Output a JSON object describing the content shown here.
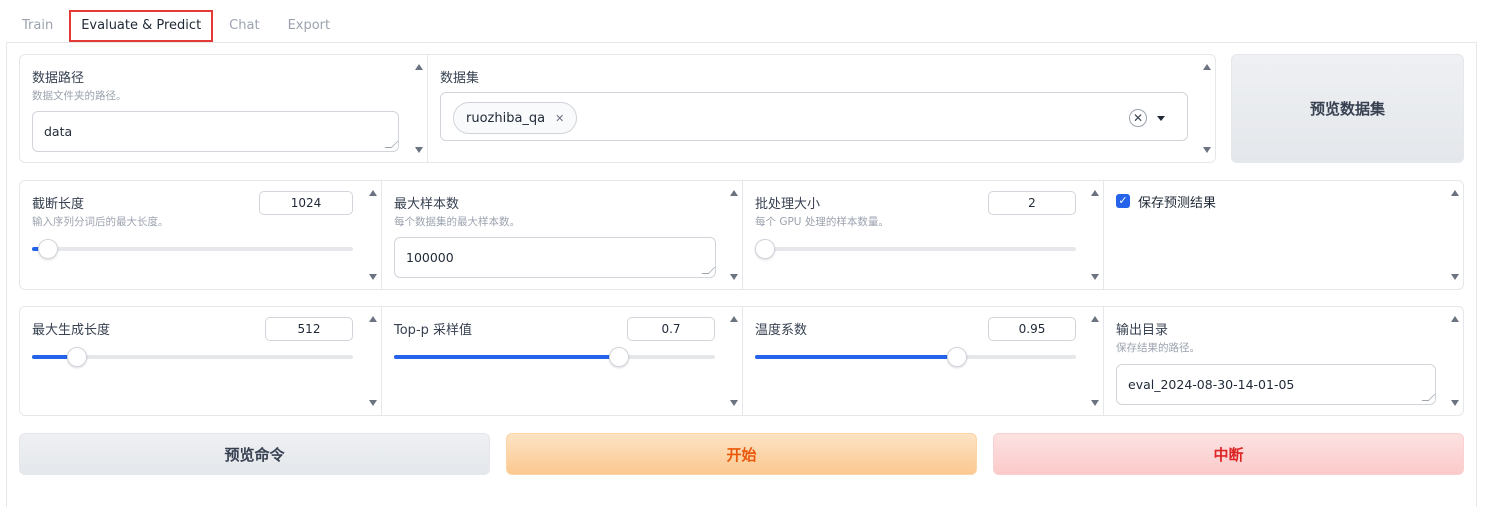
{
  "tabs": [
    {
      "label": "Train",
      "active": false
    },
    {
      "label": "Evaluate & Predict",
      "active": true
    },
    {
      "label": "Chat",
      "active": false
    },
    {
      "label": "Export",
      "active": false
    }
  ],
  "dataset_dir": {
    "label": "数据路径",
    "info": "数据文件夹的路径。",
    "value": "data"
  },
  "dataset": {
    "label": "数据集",
    "selected": [
      "ruozhiba_qa"
    ]
  },
  "preview_dataset_button": "预览数据集",
  "cutoff_len": {
    "label": "截断长度",
    "info": "输入序列分词后的最大长度。",
    "value": "1024",
    "slider_fraction": 0.05
  },
  "max_samples": {
    "label": "最大样本数",
    "info": "每个数据集的最大样本数。",
    "value": "100000"
  },
  "batch_size": {
    "label": "批处理大小",
    "info": "每个 GPU 处理的样本数量。",
    "value": "2",
    "slider_fraction": 0.0
  },
  "predict": {
    "label": "保存预测结果",
    "checked": true
  },
  "max_new_tokens": {
    "label": "最大生成长度",
    "value": "512",
    "slider_fraction": 0.14
  },
  "top_p": {
    "label": "Top-p 采样值",
    "value": "0.7",
    "slider_fraction": 0.7
  },
  "temperature": {
    "label": "温度系数",
    "value": "0.95",
    "slider_fraction": 0.63
  },
  "output_dir": {
    "label": "输出目录",
    "info": "保存结果的路径。",
    "value": "eval_2024-08-30-14-01-05"
  },
  "buttons": {
    "preview_command": "预览命令",
    "start": "开始",
    "abort": "中断"
  },
  "colors": {
    "accent": "#2563eb",
    "start_text": "#ea580c",
    "abort_text": "#dc2626",
    "tab_highlight": "#e53935"
  }
}
